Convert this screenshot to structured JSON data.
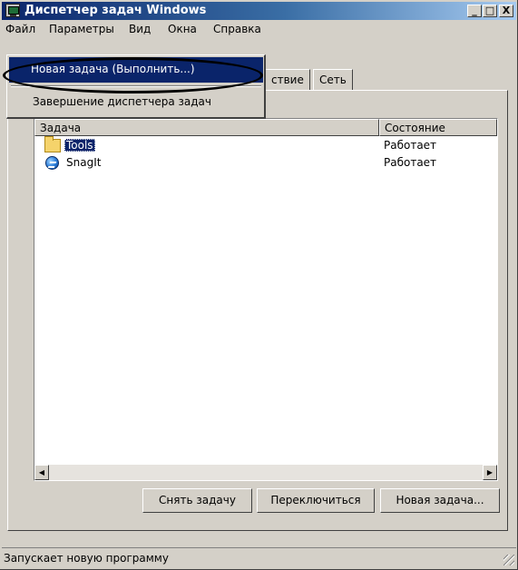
{
  "window": {
    "title": "Диспетчер задач Windows"
  },
  "titlebar_buttons": {
    "minimize": "_",
    "maximize": "□",
    "close": "X"
  },
  "menubar": {
    "items": [
      {
        "label": "Файл"
      },
      {
        "label": "Параметры"
      },
      {
        "label": "Вид"
      },
      {
        "label": "Окна"
      },
      {
        "label": "Справка"
      }
    ]
  },
  "tabs": [
    {
      "label": "ствие"
    },
    {
      "label": "Сеть"
    }
  ],
  "task_list": {
    "columns": [
      "Задача",
      "Состояние"
    ],
    "rows": [
      {
        "name": "Tools",
        "status": "Работает",
        "icon": "folder-icon",
        "selected": true
      },
      {
        "name": "SnagIt",
        "status": "Работает",
        "icon": "snagit-icon",
        "selected": false
      }
    ]
  },
  "buttons": {
    "end_task": "Снять задачу",
    "switch_to": "Переключиться",
    "new_task": "Новая задача..."
  },
  "file_menu": {
    "items": [
      {
        "label": "Новая задача (Выполнить...)",
        "highlighted": true
      },
      {
        "label": "Завершение диспетчера задач",
        "highlighted": false
      }
    ]
  },
  "statusbar": {
    "text": "Запускает новую программу"
  },
  "colors": {
    "title_gradient_start": "#0a246a",
    "title_gradient_end": "#a6caf0",
    "selection": "#0a246a",
    "face": "#d4d0c8"
  }
}
